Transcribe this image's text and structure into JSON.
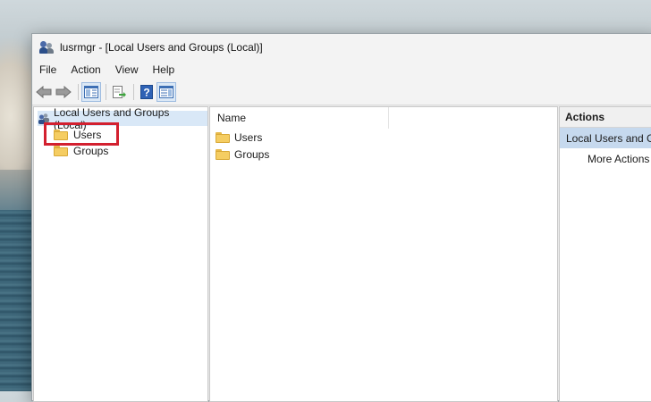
{
  "window": {
    "title": "lusrmgr - [Local Users and Groups (Local)]"
  },
  "menu": [
    "File",
    "Action",
    "View",
    "Help"
  ],
  "toolbar": {
    "icons": [
      "back-arrow-icon",
      "forward-arrow-icon",
      "show-hide-console-tree-icon",
      "export-list-icon",
      "help-icon",
      "show-hide-action-pane-icon"
    ]
  },
  "tree": {
    "root": "Local Users and Groups (Local)",
    "children": [
      "Users",
      "Groups"
    ],
    "selected": "Local Users and Groups (Local)"
  },
  "list": {
    "column": "Name",
    "items": [
      "Users",
      "Groups"
    ]
  },
  "actions": {
    "header": "Actions",
    "section": "Local Users and Groups (Local)",
    "items": [
      "More Actions"
    ]
  },
  "colors": {
    "highlight_box": "#d3202f",
    "selection": "#d9e8f7",
    "actions_section": "#c6d9ee"
  }
}
